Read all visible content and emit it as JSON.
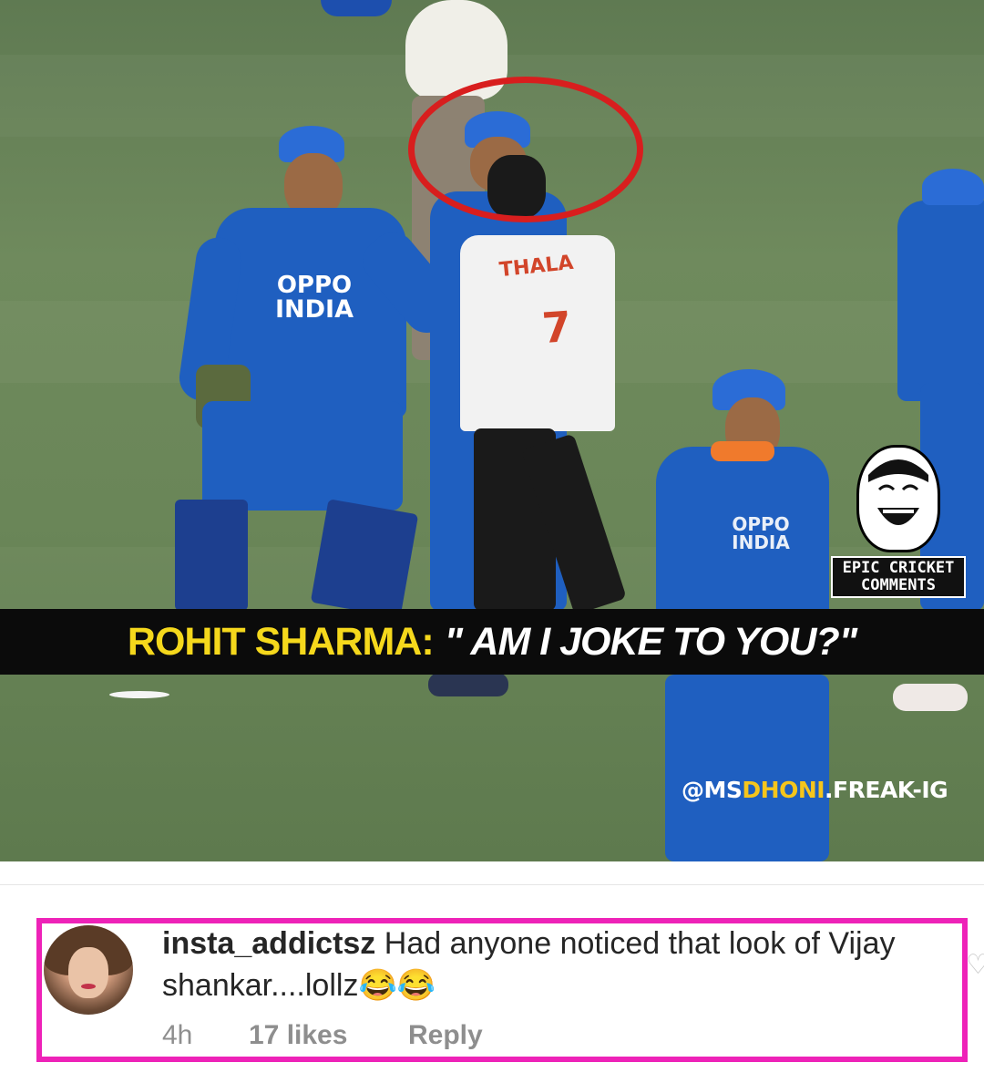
{
  "image": {
    "caption_speaker": "ROHIT SHARMA:",
    "caption_quote": "\" AM I JOKE TO YOU?\"",
    "shirt_name": "THALA",
    "shirt_number": "7",
    "sponsor_top": "OPPO",
    "sponsor_bottom": "INDIA",
    "watermark_prefix": "@MS",
    "watermark_highlight": "DHONI",
    "watermark_suffix": ".FREAK-IG",
    "logo_line1": "EPIC CRICKET",
    "logo_line2": "COMMENTS"
  },
  "comment": {
    "username": "insta_addictsz",
    "text": "Had anyone noticed that look of Vijay shankar....lollz😂😂",
    "time": "4h",
    "likes": "17 likes",
    "reply_label": "Reply"
  },
  "colors": {
    "highlight_box": "#ee22b8",
    "circle": "#d81e1e",
    "caption_speaker": "#f5d81c"
  }
}
